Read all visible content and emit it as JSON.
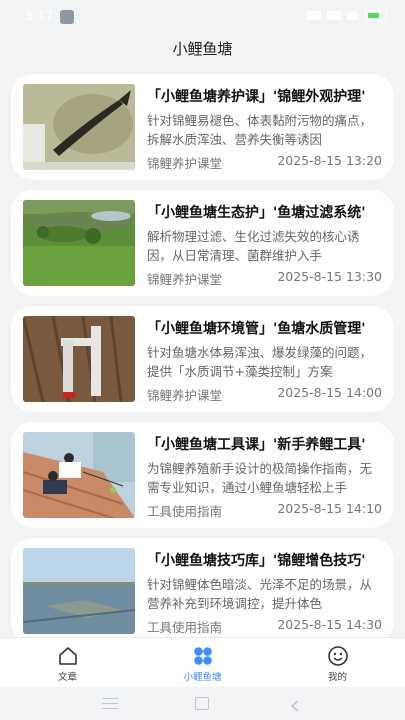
{
  "status_bar": {
    "time": "5:17"
  },
  "app": {
    "title": "小鲤鱼塘"
  },
  "articles": [
    {
      "title": "「小鲤鱼塘养护课」'锦鲤外观护理'",
      "description": "针对锦鲤易褪色、体表黏附污物的痛点，拆解水质浑浊、营养失衡等诱因",
      "source": "锦鲤养护课堂",
      "date": "2025-8-15 13:20",
      "image": "koi-in-bucket-photo"
    },
    {
      "title": "「小鲤鱼塘生态护」'鱼塘过滤系统'",
      "description": "解析物理过滤、生化过滤失效的核心诱因，从日常清理、菌群维护入手",
      "source": "锦鲤养护课堂",
      "date": "2025-8-15 13:30",
      "image": "garden-pond-photo"
    },
    {
      "title": "「小鲤鱼塘环境管」'鱼塘水质管理'",
      "description": "针对鱼塘水体易浑浊、爆发绿藻的问题，提供「水质调节+藻类控制」方案",
      "source": "锦鲤养护课堂",
      "date": "2025-8-15 14:00",
      "image": "pvc-pipe-photo"
    },
    {
      "title": "「小鲤鱼塘工具课」'新手养鲤工具'",
      "description": "为锦鲤养殖新手设计的极简操作指南，无需专业知识，通过小鲤鱼塘轻松上手",
      "source": "工具使用指南",
      "date": "2025-8-15 14:10",
      "image": "people-fishing-dock-photo"
    },
    {
      "title": "「小鲤鱼塘技巧库」'锦鲤增色技巧'",
      "description": "针对锦鲤体色暗淡、光泽不足的场景，从营养补充到环境调控，提升体色",
      "source": "工具使用指南",
      "date": "2025-8-15 14:30",
      "image": "fish-farm-ponds-photo"
    }
  ],
  "tabs": [
    {
      "label": "文章",
      "icon": "home-icon",
      "active": false
    },
    {
      "label": "小鲤鱼塘",
      "icon": "grid-dots-icon",
      "active": true
    },
    {
      "label": "我的",
      "icon": "smiley-icon",
      "active": false
    }
  ],
  "colors": {
    "accent": "#3f8efc",
    "background": "#f2f3f5",
    "card": "#ffffff"
  }
}
